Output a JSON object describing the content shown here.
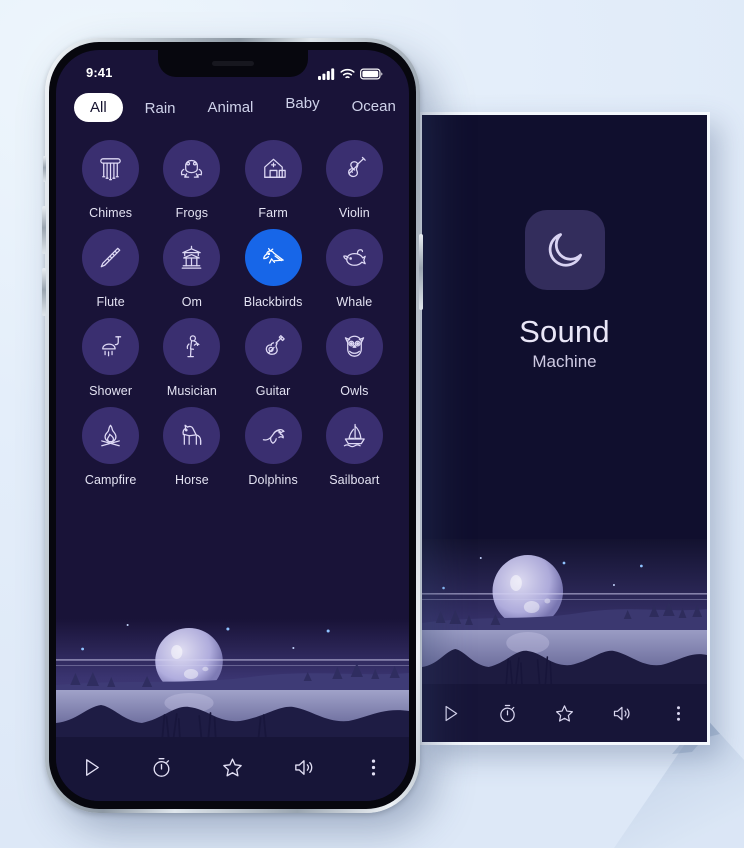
{
  "colors": {
    "page_background": "#e4eefa",
    "screen_background": "#191338",
    "card_background": "#100f2e",
    "bubble": "#3a2f70",
    "bubble_active": "#1766e8",
    "toolbar": "#171538",
    "logo_tile": "#332d5c",
    "text_primary": "#e3e2f2",
    "tab_inactive": "#cfd2ea",
    "tab_active_bg": "#ffffff",
    "tab_active_text": "#15122f",
    "phone_frame": "#b9c3cc"
  },
  "phone": {
    "status_bar": {
      "time": "9:41",
      "icons": [
        "signal-icon",
        "wifi-icon",
        "battery-icon"
      ]
    },
    "tabs": [
      {
        "label": "All",
        "active": true
      },
      {
        "label": "Rain",
        "active": false
      },
      {
        "label": "Animal",
        "active": false
      },
      {
        "label": "Baby",
        "active": false
      },
      {
        "label": "Ocean",
        "active": false
      }
    ],
    "sounds": [
      {
        "label": "Chimes",
        "icon": "chimes-icon",
        "active": false
      },
      {
        "label": "Frogs",
        "icon": "frog-icon",
        "active": false
      },
      {
        "label": "Farm",
        "icon": "barn-icon",
        "active": false
      },
      {
        "label": "Violin",
        "icon": "violin-icon",
        "active": false
      },
      {
        "label": "Flute",
        "icon": "flute-icon",
        "active": false
      },
      {
        "label": "Om",
        "icon": "pagoda-icon",
        "active": false
      },
      {
        "label": "Blackbirds",
        "icon": "bird-icon",
        "active": true
      },
      {
        "label": "Whale",
        "icon": "whale-icon",
        "active": false
      },
      {
        "label": "Shower",
        "icon": "shower-icon",
        "active": false
      },
      {
        "label": "Musician",
        "icon": "musician-icon",
        "active": false
      },
      {
        "label": "Guitar",
        "icon": "guitar-icon",
        "active": false
      },
      {
        "label": "Owls",
        "icon": "owl-icon",
        "active": false
      },
      {
        "label": "Campfire",
        "icon": "campfire-icon",
        "active": false
      },
      {
        "label": "Horse",
        "icon": "horse-icon",
        "active": false
      },
      {
        "label": "Dolphins",
        "icon": "dolphin-icon",
        "active": false
      },
      {
        "label": "Sailboart",
        "icon": "sailboat-icon",
        "active": false
      }
    ],
    "toolbar": [
      {
        "name": "play-button",
        "icon": "play-icon"
      },
      {
        "name": "timer-button",
        "icon": "stopwatch-icon"
      },
      {
        "name": "favorite-button",
        "icon": "star-icon"
      },
      {
        "name": "volume-button",
        "icon": "speaker-icon"
      },
      {
        "name": "more-button",
        "icon": "more-vertical-icon"
      }
    ]
  },
  "splash": {
    "logo_icon": "crescent-moon-icon",
    "title": "Sound",
    "subtitle": "Machine",
    "toolbar": [
      {
        "name": "play-button",
        "icon": "play-icon"
      },
      {
        "name": "timer-button",
        "icon": "stopwatch-icon"
      },
      {
        "name": "favorite-button",
        "icon": "star-icon"
      },
      {
        "name": "volume-button",
        "icon": "speaker-icon"
      },
      {
        "name": "more-button",
        "icon": "more-vertical-icon"
      }
    ]
  },
  "scene": {
    "description": "night-landscape-moon-lake"
  }
}
